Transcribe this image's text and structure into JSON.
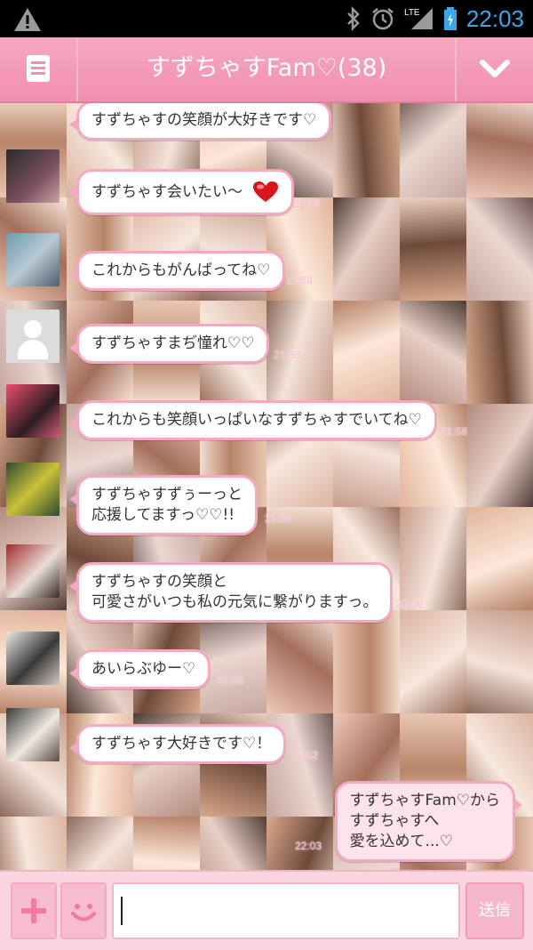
{
  "status_bar": {
    "time": "22:03",
    "network": "LTE",
    "icons": [
      "warning-icon",
      "bluetooth-icon",
      "alarm-icon",
      "signal-icon",
      "battery-icon"
    ]
  },
  "header": {
    "title": "すずちゃすFam♡(38)",
    "menu_icon": "menu-icon",
    "collapse_icon": "chevron-down-icon"
  },
  "messages": [
    {
      "text": "すずちゃすの笑顔が大好きです♡",
      "time": ""
    },
    {
      "text": "すずちゃす会いたい～",
      "emoji": "heart-emoji",
      "time": "21:58"
    },
    {
      "text": "これからもがんばってね♡",
      "time": "21:58"
    },
    {
      "text": "すずちゃすまぢ憧れ♡♡",
      "time": "21:58"
    },
    {
      "text": "これからも笑顔いっぱいなすずちゃすでいてね♡",
      "time": "21:58"
    },
    {
      "text_lines": [
        "すずちゃすずぅーっと",
        "応援してますっ♡♡!!"
      ],
      "time": "21:59"
    },
    {
      "text_lines": [
        "すずちゃすの笑顔と",
        "可愛さがいつも私の元気に繋がりますっ。"
      ],
      "time": "22:00"
    },
    {
      "text": "あいらぶゆー♡",
      "time": "22:00"
    },
    {
      "text": "すずちゃす大好きです♡！",
      "time": "22:02"
    },
    {
      "text_lines": [
        "すずちゃすFam♡から",
        "すずちゃすへ",
        "愛を込めて...♡"
      ],
      "time": "22:03",
      "self": true
    }
  ],
  "input": {
    "add_icon": "plus-icon",
    "emoji_icon": "smiley-icon",
    "value": "",
    "send_label": "送信"
  },
  "colors": {
    "accent": "#f090ae",
    "bubble_border": "#f3a9c0",
    "self_bubble": "#fde3ec",
    "status_time": "#3aa8e8"
  }
}
